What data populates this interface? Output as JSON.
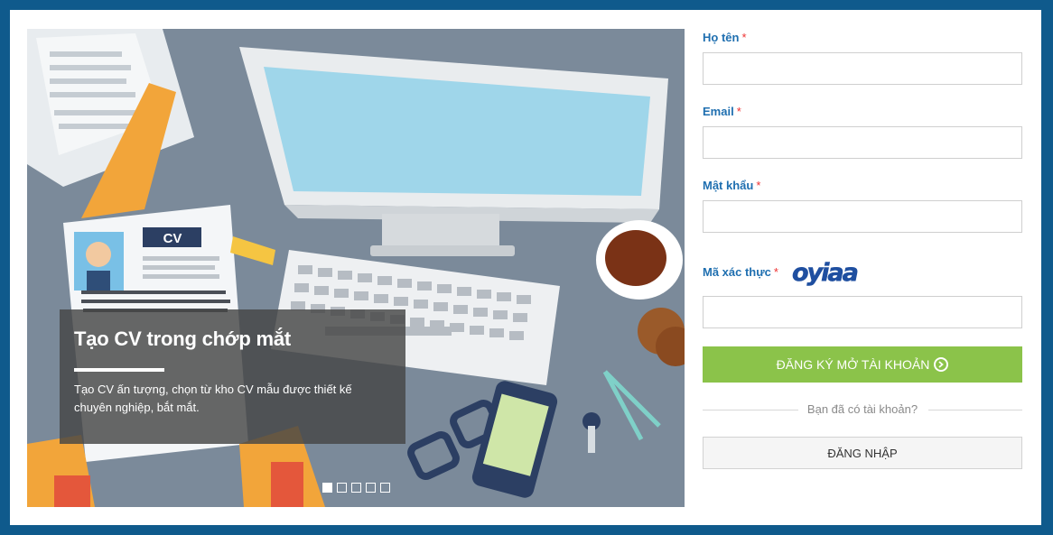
{
  "slider": {
    "caption_title": "Tạo CV trong chớp mắt",
    "caption_text": "Tạo CV ấn tượng, chọn từ kho CV mẫu được thiết kế chuyên nghiệp, bắt mắt.",
    "cv_tag": "CV",
    "slide_count": 5,
    "active_slide": 1
  },
  "form": {
    "name_label": "Họ tên",
    "email_label": "Email",
    "password_label": "Mật khẩu",
    "captcha_label": "Mã xác thực",
    "required_mark": "*",
    "captcha_text": "oyiaa",
    "name_value": "",
    "email_value": "",
    "password_value": "",
    "captcha_value": "",
    "register_button": "ĐĂNG KÝ MỞ TÀI KHOẢN",
    "have_account_text": "Bạn đã có tài khoản?",
    "login_button": "ĐĂNG NHẬP"
  },
  "colors": {
    "frame": "#0f5a8c",
    "label": "#1f6fb0",
    "register_button": "#8bc34a",
    "required": "#e33333"
  },
  "icons": {
    "register_arrow": "chevron-circle-right-icon"
  }
}
